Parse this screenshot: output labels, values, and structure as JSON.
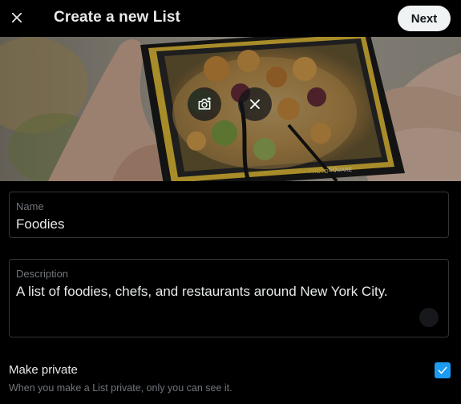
{
  "header": {
    "title": "Create a new List",
    "next_label": "Next",
    "close_icon": "close-icon"
  },
  "banner": {
    "image": "food-phone-photo",
    "camera_icon": "add-photo-icon",
    "remove_icon": "close-icon"
  },
  "form": {
    "name": {
      "label": "Name",
      "value": "Foodies"
    },
    "description": {
      "label": "Description",
      "value": "A list of foodies, chefs, and restaurants around New York City."
    }
  },
  "privacy": {
    "label": "Make private",
    "help": "When you make a List private, only you can see it.",
    "checked": true
  },
  "colors": {
    "background": "#000000",
    "accent": "#1d9bf0",
    "text_primary": "#e7e9ea",
    "text_secondary": "#71767b",
    "border": "#333639",
    "next_bg": "#eff3f4"
  }
}
